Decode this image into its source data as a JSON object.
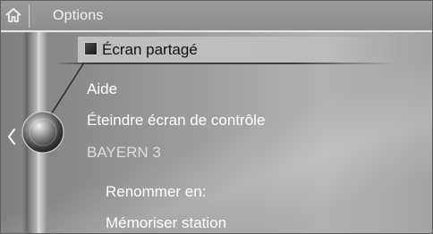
{
  "header": {
    "title": "Options",
    "home_icon": "home-icon"
  },
  "menu": {
    "items": [
      {
        "label": "Écran partagé",
        "selected": true
      },
      {
        "label": "Aide"
      },
      {
        "label": "Éteindre écran de contrôle"
      },
      {
        "label": "BAYERN 3",
        "dimmed": true
      },
      {
        "label": "Renommer en:",
        "indented": true
      },
      {
        "label": "Mémoriser station",
        "indented": true
      }
    ]
  },
  "controller": {
    "icon": "controller-knob-icon",
    "left_icon": "chevron-left-icon"
  },
  "colors": {
    "background": "#9a9a9a",
    "text": "#ffffff",
    "selected_text": "#111111"
  }
}
